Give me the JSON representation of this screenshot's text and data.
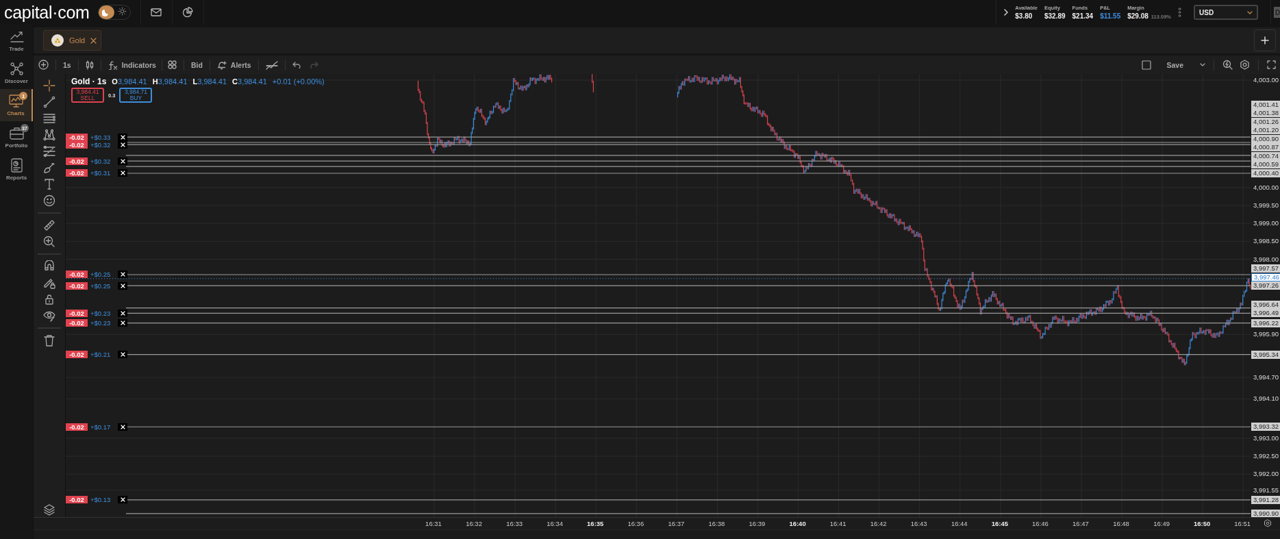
{
  "topbar": {
    "logo": "capital·com",
    "theme": {
      "dark": true
    },
    "account": [
      {
        "label": "Available",
        "value": "$3.80",
        "kind": "plain"
      },
      {
        "label": "Equity",
        "value": "$32.89",
        "kind": "plain"
      },
      {
        "label": "Funds",
        "value": "$21.34",
        "kind": "plain"
      },
      {
        "label": "P&L",
        "value": "$11.55",
        "kind": "profit"
      },
      {
        "label": "Margin",
        "value": "$29.08",
        "kind": "plain",
        "extra": "113.09%"
      }
    ],
    "currency": "USD",
    "cut_button": "D"
  },
  "sidebar": {
    "items": [
      {
        "label": "Trade",
        "selected": false
      },
      {
        "label": "Discover",
        "selected": false
      },
      {
        "label": "Charts",
        "selected": true,
        "badge": "1"
      },
      {
        "label": "Portfolio",
        "selected": false,
        "badge": "37"
      },
      {
        "label": "Reports",
        "selected": false
      }
    ]
  },
  "tabs": [
    {
      "label": "Gold",
      "selected": true
    }
  ],
  "toolbar": {
    "interval": "1s",
    "indicators": "Indicators",
    "price_type": "Bid",
    "alerts": "Alerts",
    "save": "Save",
    "checkbox_checked": false,
    "undo_disabled": false,
    "redo_disabled": true
  },
  "legend": {
    "symbol": "Gold · 1s",
    "ohlc": [
      {
        "key": "O",
        "value": "3,984.41"
      },
      {
        "key": "H",
        "value": "3,984.41"
      },
      {
        "key": "L",
        "value": "3,984.41"
      },
      {
        "key": "C",
        "value": "3,984.41"
      }
    ],
    "change": "+0.01 (+0.00%)"
  },
  "trade": {
    "sell_price": "3,984.41",
    "sell": "SELL",
    "spread": "0.3",
    "buy_price": "3,984.71",
    "buy": "BUY"
  },
  "drawing_tools": [
    {
      "selected": true
    },
    {
      "selected": false
    },
    {
      "selected": false
    },
    {
      "selected": false
    },
    {
      "selected": false
    },
    {
      "selected": false
    },
    {
      "selected": false
    },
    {
      "selected": false
    },
    {
      "selected": false
    },
    {
      "selected": false
    },
    {
      "selected": false
    },
    {
      "selected": false
    },
    {
      "selected": false
    },
    {
      "selected": false
    },
    {
      "selected": false
    }
  ],
  "order_lines": [
    {
      "price": "4,001.41",
      "size": "-0.02",
      "pnl": "+$0.33"
    },
    {
      "price": "4,001.38"
    },
    {
      "price": "4,001.26"
    },
    {
      "price": "4,001.20",
      "size": "-0.02",
      "pnl": "+$0.32"
    },
    {
      "price": "4,000.90"
    },
    {
      "price": "4,000.87"
    },
    {
      "price": "4,000.74",
      "size": "-0.02",
      "pnl": "+$0.32"
    },
    {
      "price": "4,000.59"
    },
    {
      "price": "4,000.40",
      "size": "-0.02",
      "pnl": "+$0.31"
    },
    {
      "price": "3,997.57",
      "size": "-0.02",
      "pnl": "+$0.25"
    },
    {
      "price": "3,997.26",
      "size": "-0.02",
      "pnl": "+$0.25"
    },
    {
      "price": "3,996.64"
    },
    {
      "price": "3,996.49",
      "size": "-0.02",
      "pnl": "+$0.23"
    },
    {
      "price": "3,996.22",
      "size": "-0.02",
      "pnl": "+$0.23"
    },
    {
      "price": "3,995.34",
      "size": "-0.02",
      "pnl": "+$0.21"
    },
    {
      "price": "3,993.32",
      "size": "-0.02",
      "pnl": "+$0.17"
    },
    {
      "price": "3,991.28",
      "size": "-0.02",
      "pnl": "+$0.13"
    },
    {
      "price": "3,990.90"
    }
  ],
  "current_price": "3,997.46",
  "price_axis": [
    "4,003.00",
    "4,000.00",
    "3,999.50",
    "3,999.00",
    "3,998.50",
    "3,998.00",
    "3,995.90",
    "3,994.70",
    "3,994.10",
    "3,993.00",
    "3,992.50",
    "3,992.00",
    "3,991.55"
  ],
  "time_axis": [
    {
      "label": "16:31",
      "major": false
    },
    {
      "label": "16:32",
      "major": false
    },
    {
      "label": "16:33",
      "major": false
    },
    {
      "label": "16:34",
      "major": false
    },
    {
      "label": "16:35",
      "major": true
    },
    {
      "label": "16:36",
      "major": false
    },
    {
      "label": "16:37",
      "major": false
    },
    {
      "label": "16:38",
      "major": false
    },
    {
      "label": "16:39",
      "major": false
    },
    {
      "label": "16:40",
      "major": true
    },
    {
      "label": "16:41",
      "major": false
    },
    {
      "label": "16:42",
      "major": false
    },
    {
      "label": "16:43",
      "major": false
    },
    {
      "label": "16:44",
      "major": false
    },
    {
      "label": "16:45",
      "major": true
    },
    {
      "label": "16:46",
      "major": false
    },
    {
      "label": "16:47",
      "major": false
    },
    {
      "label": "16:48",
      "major": false
    },
    {
      "label": "16:49",
      "major": false
    },
    {
      "label": "16:50",
      "major": true
    },
    {
      "label": "16:51",
      "major": false
    }
  ]
}
